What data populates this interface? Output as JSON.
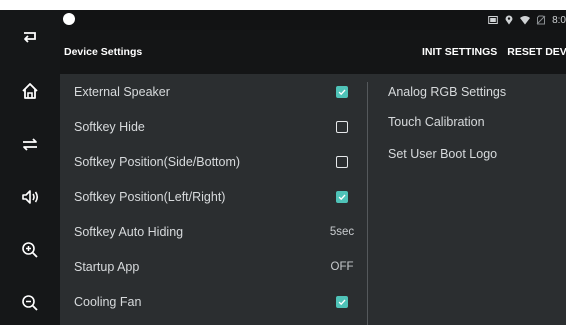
{
  "softkeys": [
    {
      "icon": "back-icon"
    },
    {
      "icon": "home-icon"
    },
    {
      "icon": "recent-apps-icon"
    },
    {
      "icon": "volume-icon"
    },
    {
      "icon": "zoom-in-icon"
    },
    {
      "icon": "zoom-out-icon"
    }
  ],
  "status_bar": {
    "time": "8:0",
    "icons": [
      "cast-icon",
      "location-icon",
      "wifi-icon",
      "no-sim-icon"
    ]
  },
  "app_bar": {
    "title": "Device Settings",
    "init_settings": "INIT SETTINGS",
    "reset_device": "RESET DEVICE"
  },
  "settings": [
    {
      "label": "External Speaker",
      "type": "checkbox",
      "checked": true
    },
    {
      "label": "Softkey Hide",
      "type": "checkbox",
      "checked": false
    },
    {
      "label": "Softkey Position(Side/Bottom)",
      "type": "checkbox",
      "checked": false
    },
    {
      "label": "Softkey Position(Left/Right)",
      "type": "checkbox",
      "checked": true
    },
    {
      "label": "Softkey Auto Hiding",
      "type": "value",
      "value": "5sec"
    },
    {
      "label": "Startup App",
      "type": "value",
      "value": "OFF"
    },
    {
      "label": "Cooling Fan",
      "type": "checkbox",
      "checked": true
    }
  ],
  "right_links": [
    "Analog RGB Settings",
    "Touch Calibration",
    "Set User Boot Logo"
  ],
  "colors": {
    "accent": "#4fc3b8",
    "background": "#2b2e30",
    "bar": "#141516"
  }
}
